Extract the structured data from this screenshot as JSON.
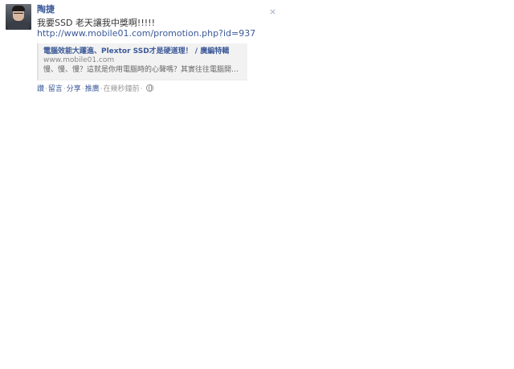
{
  "post": {
    "author": "陶捷",
    "message": "我要SSD 老天讓我中獎啊!!!!!",
    "link_url": "http://www.mobile01.com/promotion.php?id=937",
    "close_glyph": "×",
    "attachment": {
      "title": "電腦效能大躍進、Plextor SSD才是硬道理！ / 廣編特輯",
      "domain": "www.mobile01.com",
      "description": "慢、慢、慢？這就是你用電腦時的心聲嗎？其實往往電腦開機慢、讀..."
    },
    "actions": {
      "like": "讚",
      "comment": "留言",
      "share": "分享",
      "promote": "推廣",
      "timestamp": "在幾秒鐘前"
    }
  }
}
